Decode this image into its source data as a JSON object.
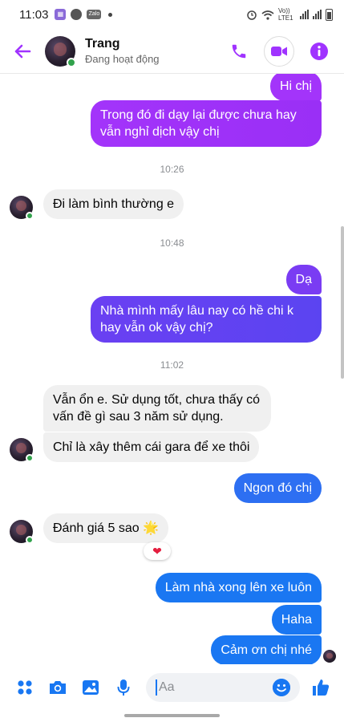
{
  "status_bar": {
    "time": "11:03",
    "network_label": "Vo)) LTE1",
    "icons": [
      "alarm-icon",
      "wifi-icon",
      "signal-icon",
      "battery-icon"
    ]
  },
  "header": {
    "contact_name": "Trang",
    "presence": "Đang hoạt động",
    "accent_color": "#a033ff",
    "icons": [
      "back-arrow-icon",
      "phone-icon",
      "video-icon",
      "info-icon"
    ]
  },
  "messages": [
    {
      "direction": "out",
      "text": "Hi chị"
    },
    {
      "direction": "out",
      "text": "Trong đó đi dạy lại được chưa hay vẫn nghỉ dịch vậy chị"
    },
    {
      "type": "timestamp",
      "text": "10:26"
    },
    {
      "direction": "in",
      "text": "Đi làm bình thường e"
    },
    {
      "type": "timestamp",
      "text": "10:48"
    },
    {
      "direction": "out",
      "text": "Dạ"
    },
    {
      "direction": "out",
      "text": "Nhà mình mấy lâu nay có hề chi k hay vẫn ok vậy chị?"
    },
    {
      "type": "timestamp",
      "text": "11:02"
    },
    {
      "direction": "in",
      "text": "Vẫn ổn e. Sử dụng tốt, chưa thấy có vấn đề gì sau 3 năm sử dụng."
    },
    {
      "direction": "in",
      "text": "Chỉ là xây thêm cái gara để xe thôi"
    },
    {
      "direction": "out",
      "text": "Ngon đó chị"
    },
    {
      "direction": "in",
      "text": "Đánh giá 5 sao 🌟",
      "reaction": "❤"
    },
    {
      "direction": "out",
      "text": "Làm nhà xong lên xe luôn"
    },
    {
      "direction": "out",
      "text": "Haha"
    },
    {
      "direction": "out",
      "text": "Cảm ơn chị nhé"
    }
  ],
  "composer": {
    "placeholder": "Aa",
    "icons": [
      "apps-grid-icon",
      "camera-icon",
      "gallery-icon",
      "microphone-icon",
      "emoji-icon",
      "like-thumb-icon"
    ]
  },
  "colors": {
    "gradient_purple": "#a334fa",
    "gradient_mid": "#6b3cf2",
    "gradient_blue": "#1a77f2",
    "incoming_bg": "#f0f0f0",
    "online": "#31a24c",
    "composer_blue": "#1877f2"
  }
}
